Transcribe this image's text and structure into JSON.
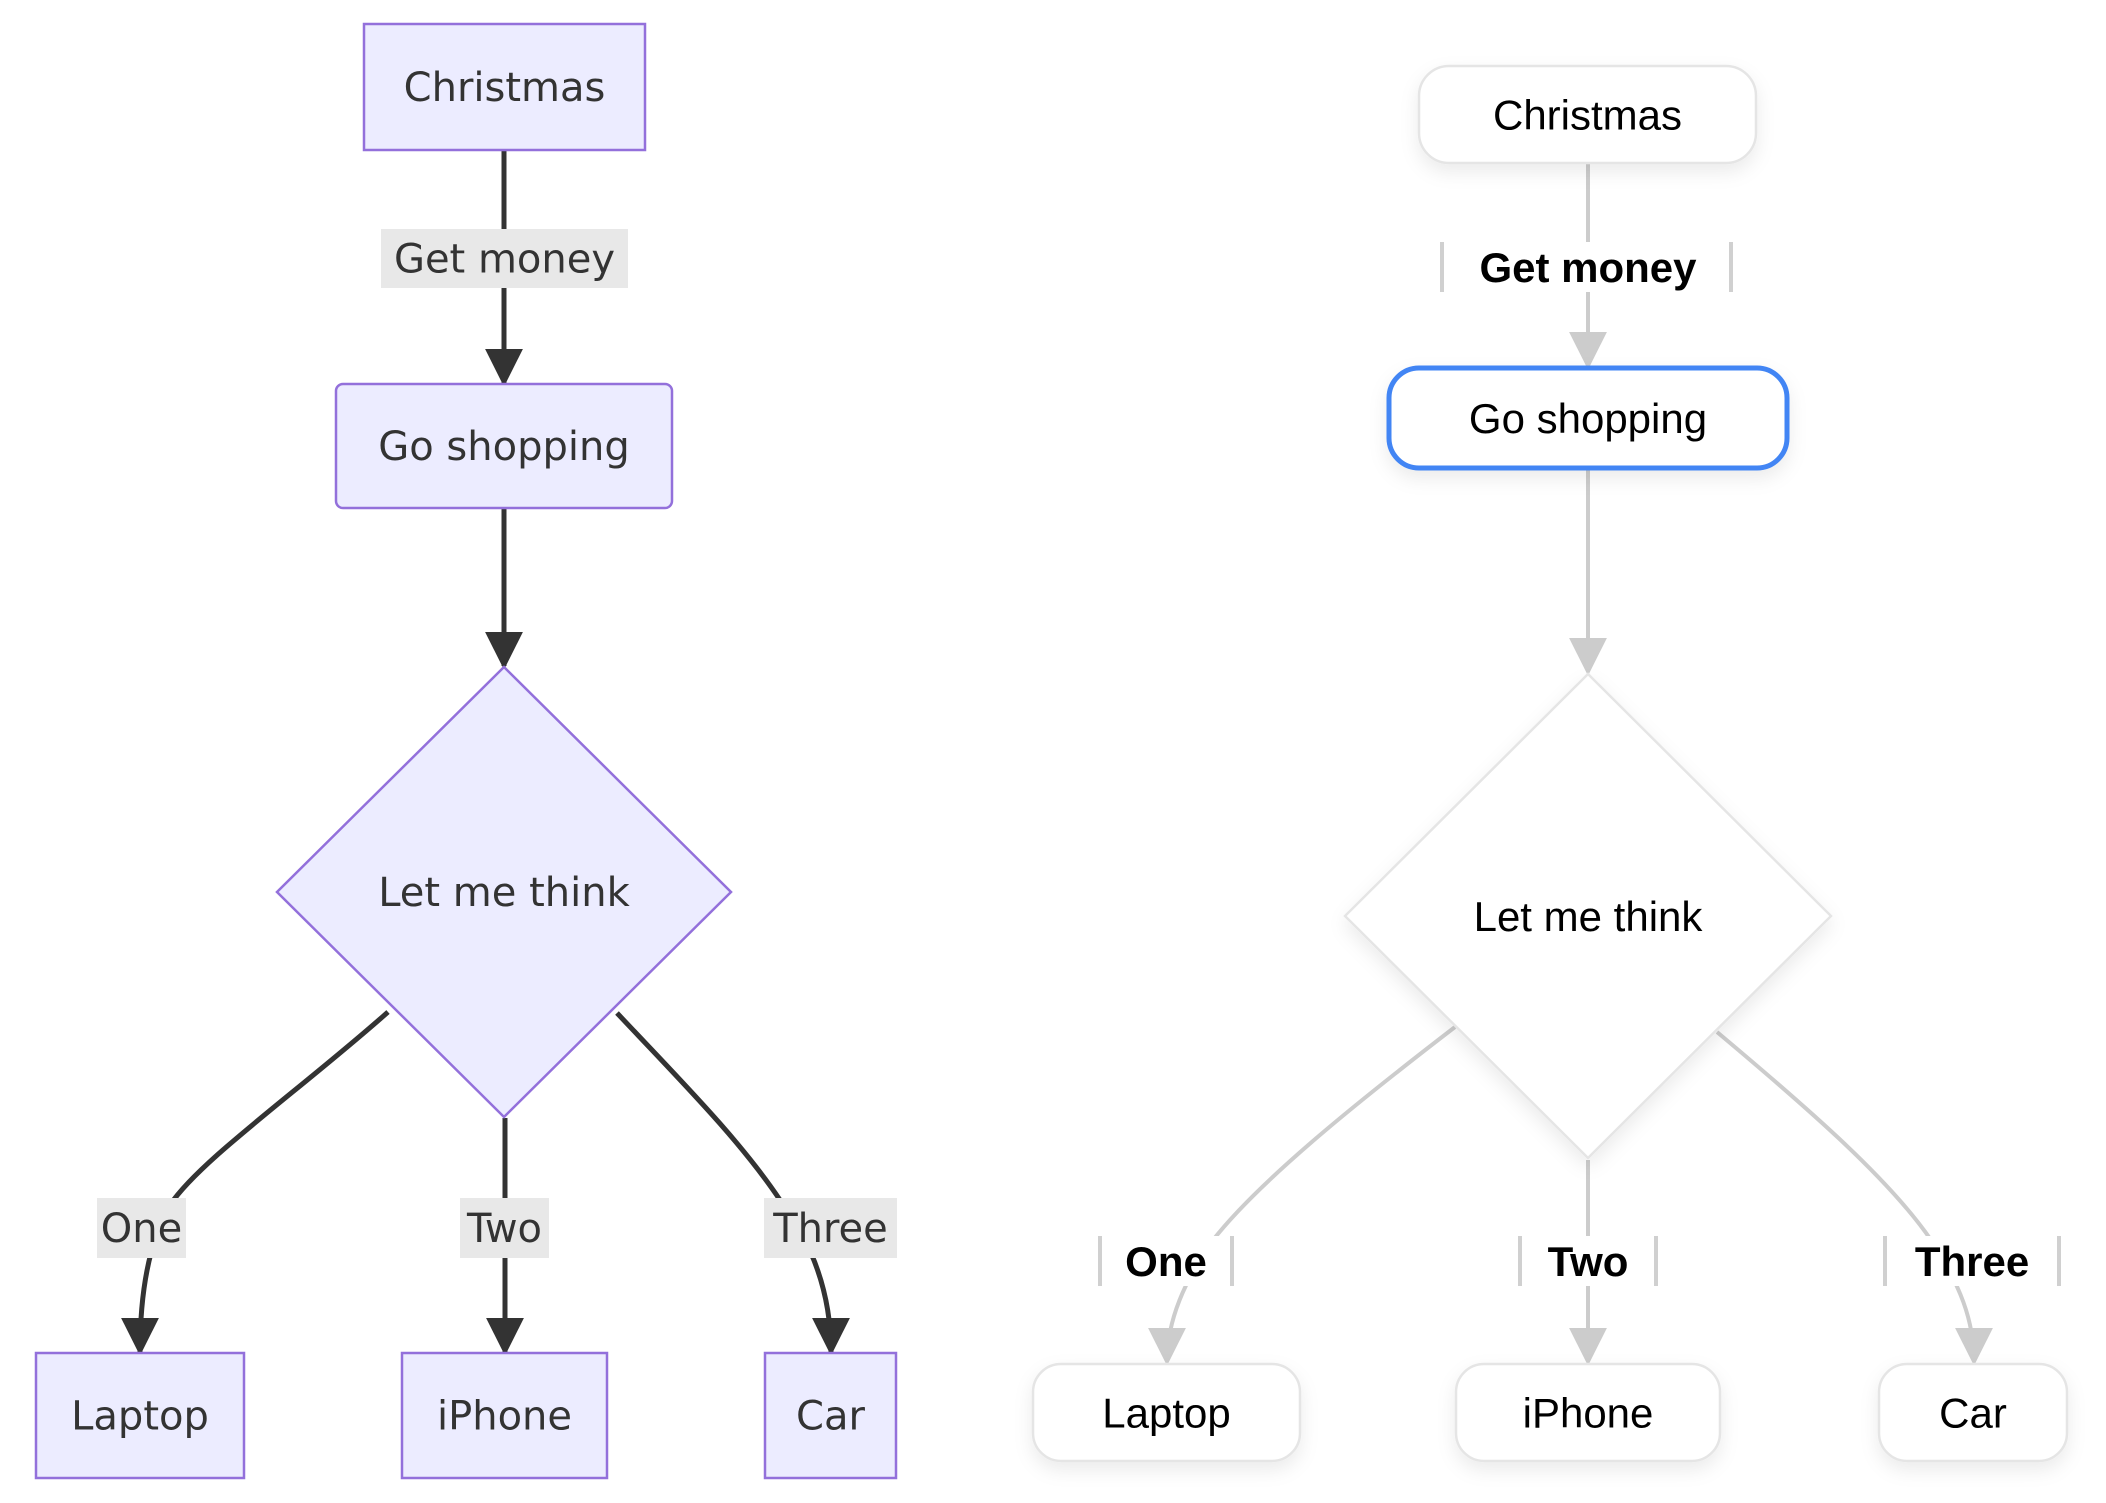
{
  "diagrams": [
    {
      "id": "classic",
      "theme": {
        "node_fill": "#ECECFF",
        "node_stroke": "#9370DB",
        "edge_color": "#333333",
        "label_bg": "#E8E8E8",
        "text_color": "#333333"
      },
      "nodes": [
        {
          "id": "A",
          "label": "Christmas",
          "shape": "rect"
        },
        {
          "id": "B",
          "label": "Go shopping",
          "shape": "round"
        },
        {
          "id": "C",
          "label": "Let me think",
          "shape": "diamond"
        },
        {
          "id": "D",
          "label": "Laptop",
          "shape": "rect"
        },
        {
          "id": "E",
          "label": "iPhone",
          "shape": "rect"
        },
        {
          "id": "F",
          "label": "Car",
          "shape": "rect"
        }
      ],
      "edges": [
        {
          "from": "A",
          "to": "B",
          "label": "Get money"
        },
        {
          "from": "B",
          "to": "C",
          "label": ""
        },
        {
          "from": "C",
          "to": "D",
          "label": "One"
        },
        {
          "from": "C",
          "to": "E",
          "label": "Two"
        },
        {
          "from": "C",
          "to": "F",
          "label": "Three"
        }
      ]
    },
    {
      "id": "neo",
      "theme": {
        "node_fill": "#FFFFFF",
        "node_stroke": "#E5E5E5",
        "selected_stroke": "#4285F4",
        "edge_color": "#CCCCCC",
        "label_bar_color": "#D0D0D0",
        "text_color": "#000000"
      },
      "selected_node": "B",
      "nodes": [
        {
          "id": "A",
          "label": "Christmas",
          "shape": "round"
        },
        {
          "id": "B",
          "label": "Go shopping",
          "shape": "round"
        },
        {
          "id": "C",
          "label": "Let me think",
          "shape": "diamond"
        },
        {
          "id": "D",
          "label": "Laptop",
          "shape": "round"
        },
        {
          "id": "E",
          "label": "iPhone",
          "shape": "round"
        },
        {
          "id": "F",
          "label": "Car",
          "shape": "round"
        }
      ],
      "edges": [
        {
          "from": "A",
          "to": "B",
          "label": "Get money"
        },
        {
          "from": "B",
          "to": "C",
          "label": ""
        },
        {
          "from": "C",
          "to": "D",
          "label": "One"
        },
        {
          "from": "C",
          "to": "E",
          "label": "Two"
        },
        {
          "from": "C",
          "to": "F",
          "label": "Three"
        }
      ]
    }
  ]
}
